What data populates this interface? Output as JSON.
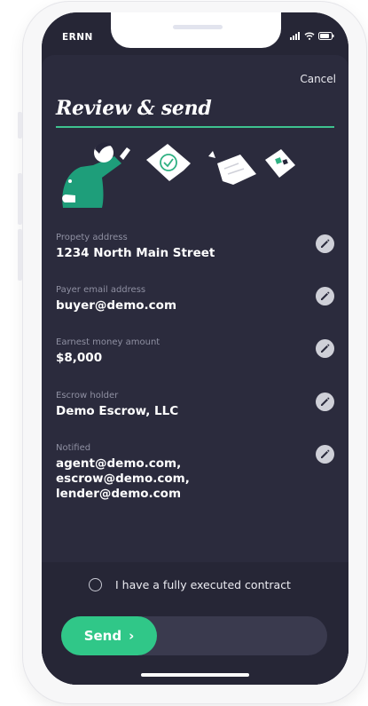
{
  "status_bar": {
    "carrier": "ERNN"
  },
  "header": {
    "cancel_label": "Cancel",
    "title": "Review & send"
  },
  "fields": [
    {
      "label": "Propety address",
      "value": "1234 North Main Street"
    },
    {
      "label": "Payer email address",
      "value": "buyer@demo.com"
    },
    {
      "label": "Earnest money amount",
      "value": "$8,000"
    },
    {
      "label": "Escrow holder",
      "value": "Demo Escrow, LLC"
    },
    {
      "label": "Notified",
      "value": "agent@demo.com, escrow@demo.com, lender@demo.com"
    }
  ],
  "contract_checkbox": {
    "label": "I have a fully executed contract",
    "checked": false
  },
  "send": {
    "label": "Send",
    "arrow": "›"
  },
  "colors": {
    "background": "#262636",
    "sheet": "#2b2b3d",
    "accent": "#30c788",
    "rule": "#3ec28f"
  },
  "icons": [
    "signal-icon",
    "wifi-icon",
    "battery-icon",
    "pencil-icon",
    "chevron-right-icon",
    "person-illustration",
    "document-illustration"
  ]
}
